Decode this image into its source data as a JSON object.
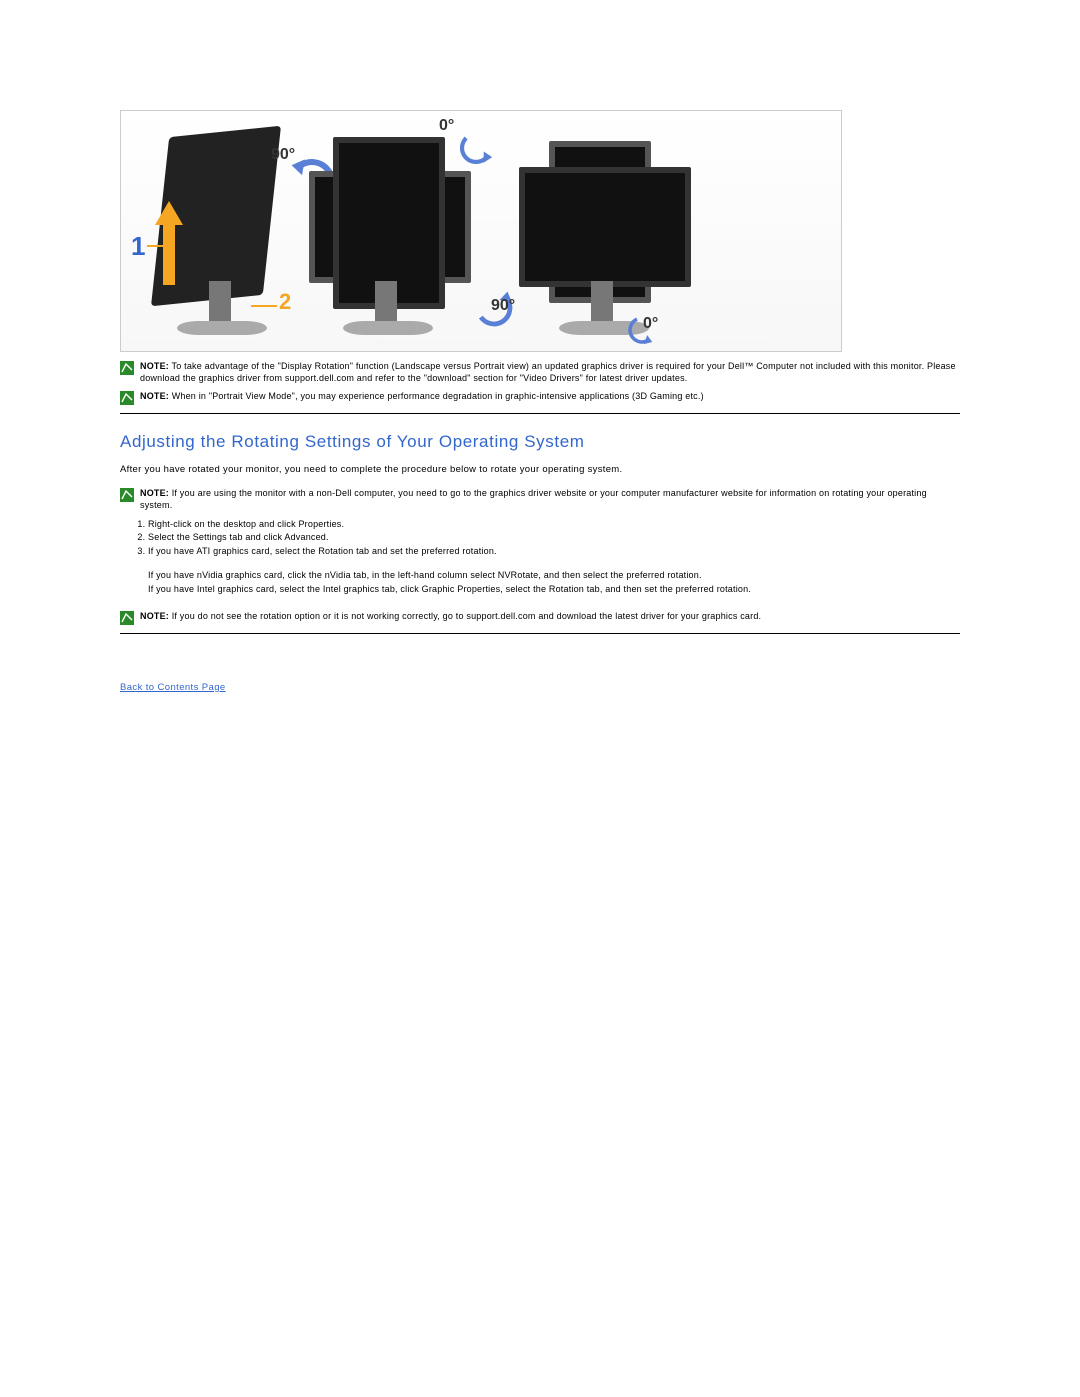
{
  "figure": {
    "step1": "1",
    "step2": "2",
    "angle90a": "90°",
    "angle0a": "0°",
    "angle90b": "90°",
    "angle0b": "0°"
  },
  "notes": {
    "first_label": "NOTE:",
    "first_body": " To take advantage of the \"Display Rotation\" function (Landscape versus Portrait view) an updated graphics driver is required for your Dell™ Computer not included with this monitor. Please download the graphics driver from support.dell.com and refer to the \"download\" section for \"Video Drivers\" for latest driver updates.",
    "second_label": "NOTE:",
    "second_body": " When in \"Portrait View Mode\", you may experience performance degradation in graphic-intensive applications (3D Gaming etc.)"
  },
  "heading": "Adjusting the Rotating Settings of Your Operating System",
  "intro": "After you have rotated your monitor, you need to complete the procedure below to rotate your operating system.",
  "note_nondell_label": "NOTE:",
  "note_nondell_body": " If you are using the monitor with a non-Dell computer, you need to go to the graphics driver website or your computer manufacturer website for information on rotating your operating system.",
  "steps": {
    "s1": "Right-click on the desktop and click Properties.",
    "s2": "Select the Settings tab and click Advanced.",
    "s3": "If you have ATI graphics card, select the Rotation tab and set the preferred rotation.",
    "s3b": "If you have nVidia graphics card, click the nVidia tab, in the left-hand column select NVRotate, and then select the preferred rotation.",
    "s3c": "If you have Intel graphics card, select the Intel graphics tab, click Graphic Properties, select the Rotation tab, and then set the preferred rotation."
  },
  "note_norotate_label": "NOTE:",
  "note_norotate_body": " If you do not see the rotation option or it is not working correctly, go to support.dell.com and download the latest driver for your graphics card.",
  "back_link": "Back to Contents Page"
}
